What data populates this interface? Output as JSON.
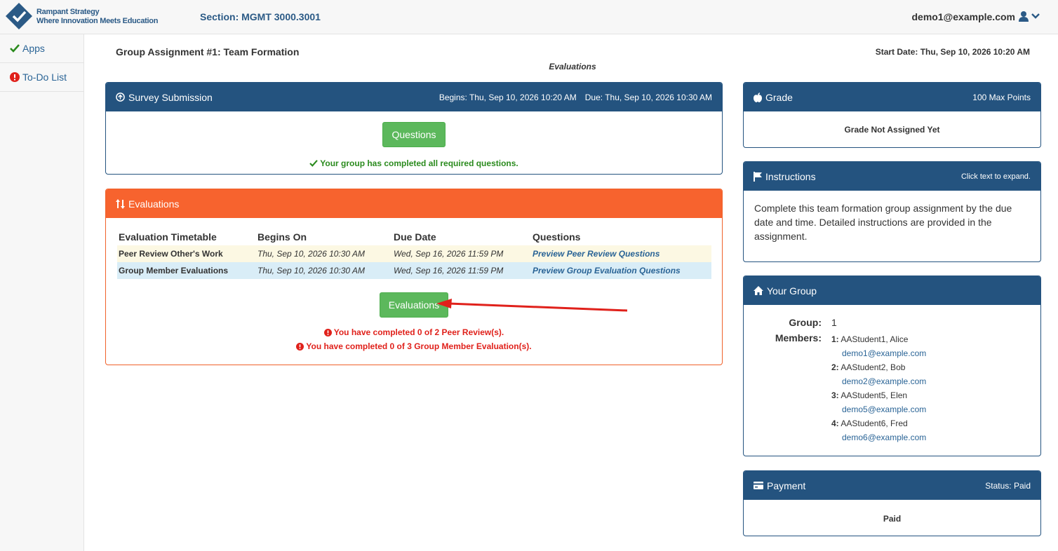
{
  "brand": {
    "line1": "Rampant Strategy",
    "line2": "Where Innovation Meets Education"
  },
  "header": {
    "section": "Section: MGMT 3000.3001",
    "user_email": "demo1@example.com"
  },
  "sidebar": {
    "items": [
      {
        "label": "Apps",
        "icon": "check-icon"
      },
      {
        "label": "To-Do List",
        "icon": "exclamation-circle-icon"
      }
    ]
  },
  "assignment": {
    "title": "Group Assignment #1: Team Formation",
    "start_date": "Start Date: Thu, Sep 10, 2026 10:20 AM",
    "phase_label": "Evaluations"
  },
  "survey": {
    "title": "Survey Submission",
    "begins": "Begins: Thu, Sep 10, 2026 10:20 AM",
    "due": "Due: Thu, Sep 10, 2026 10:30 AM",
    "button": "Questions",
    "status": "Your group has completed all required questions."
  },
  "evaluations": {
    "title": "Evaluations",
    "columns": [
      "Evaluation Timetable",
      "Begins On",
      "Due Date",
      "Questions"
    ],
    "rows": [
      {
        "name": "Peer Review Other's Work",
        "begins": "Thu, Sep 10, 2026 10:30 AM",
        "due": "Wed, Sep 16, 2026 11:59 PM",
        "link": "Preview Peer Review Questions"
      },
      {
        "name": "Group Member Evaluations",
        "begins": "Thu, Sep 10, 2026 10:30 AM",
        "due": "Wed, Sep 16, 2026 11:59 PM",
        "link": "Preview Group Evaluation Questions"
      }
    ],
    "button": "Evaluations",
    "messages": [
      "You have completed 0 of 2 Peer Review(s).",
      "You have completed 0 of 3 Group Member Evaluation(s)."
    ]
  },
  "grade": {
    "title": "Grade",
    "max_points": "100 Max Points",
    "body": "Grade Not Assigned Yet"
  },
  "instructions": {
    "title": "Instructions",
    "hint": "Click text to expand.",
    "body": "Complete this team formation group assignment by the due date and time. Detailed instructions are provided in the assignment."
  },
  "group": {
    "title": "Your Group",
    "group_label": "Group:",
    "group_value": "1",
    "members_label": "Members:",
    "members": [
      {
        "num": "1:",
        "name": "AAStudent1, Alice",
        "email": "demo1@example.com"
      },
      {
        "num": "2:",
        "name": "AAStudent2, Bob",
        "email": "demo2@example.com"
      },
      {
        "num": "3:",
        "name": "AAStudent5, Elen",
        "email": "demo5@example.com"
      },
      {
        "num": "4:",
        "name": "AAStudent6, Fred",
        "email": "demo6@example.com"
      }
    ]
  },
  "payment": {
    "title": "Payment",
    "status": "Status: Paid",
    "body": "Paid"
  },
  "colors": {
    "navy": "#24537f",
    "orange": "#f7632e",
    "green": "#5cb85c",
    "error_red": "#e0211b",
    "success_green": "#2b8b1e"
  }
}
